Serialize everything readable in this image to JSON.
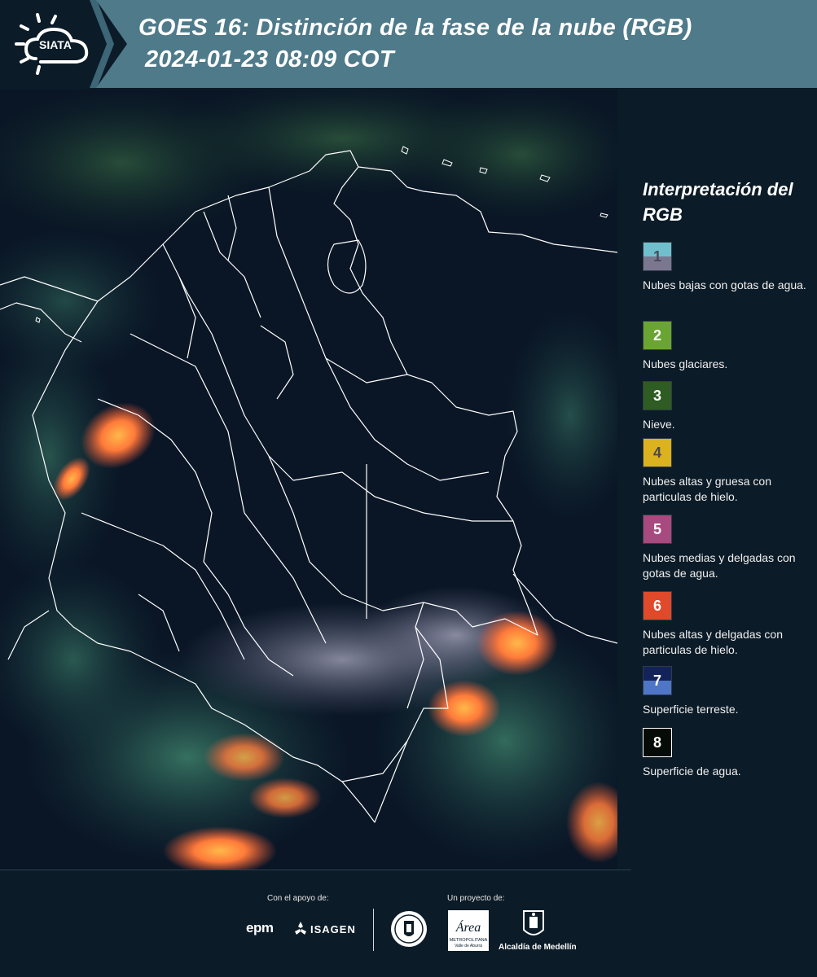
{
  "header": {
    "logo_text": "SIATA",
    "title_line1": "GOES 16: Distinción de la fase de la nube (RGB)",
    "title_line2": "2024-01-23 08:09 COT"
  },
  "legend": {
    "title": "Interpretación del RGB",
    "items": [
      {
        "number": "1",
        "label": "Nubes bajas con gotas de agua.",
        "color_top": "#6fc0cc",
        "color_bottom": "#7b7790",
        "num_color": "#4a4a5a"
      },
      {
        "number": "2",
        "label": "Nubes glaciares.",
        "color_top": "#6aa533",
        "color_bottom": "#6aa533",
        "num_color": "#ffffff"
      },
      {
        "number": "3",
        "label": "Nieve.",
        "color_top": "#2e5c22",
        "color_bottom": "#2e5c22",
        "num_color": "#ffffff"
      },
      {
        "number": "4",
        "label": "Nubes altas y gruesa con particulas de hielo.",
        "color_top": "#ddb21f",
        "color_bottom": "#ddb21f",
        "num_color": "#4a4a4a"
      },
      {
        "number": "5",
        "label": "Nubes medias y delgadas con gotas de agua.",
        "color_top": "#a84a7f",
        "color_bottom": "#a84a7f",
        "num_color": "#ffffff"
      },
      {
        "number": "6",
        "label": "Nubes altas y delgadas con particulas de hielo.",
        "color_top": "#e0492a",
        "color_bottom": "#e0492a",
        "num_color": "#ffffff"
      },
      {
        "number": "7",
        "label": "Superficie terreste.",
        "color_top": "#132359",
        "color_bottom": "#4f76c6",
        "num_color": "#ffffff"
      },
      {
        "number": "8",
        "label": "Superficie de agua.",
        "color_top": "#050b07",
        "color_bottom": "#050b07",
        "num_color": "#ffffff"
      }
    ]
  },
  "footer": {
    "support_label": "Con el apoyo de:",
    "project_label": "Un proyecto de:",
    "sponsor1": "epm",
    "sponsor2": "ISAGEN",
    "partner_area": "Área",
    "partner_area_sub1": "METROPOLITANA",
    "partner_area_sub2": "Valle de Aburrá",
    "partner_alcaldia": "Alcaldía de Medellín"
  },
  "colors": {
    "header_band": "#4e7a8a",
    "background": "#0b1b27",
    "map_background": "#0a1423",
    "cloud_orange": "#ff7a3a",
    "cloud_green": "#3d8a6a",
    "border_line": "#ffffff"
  }
}
